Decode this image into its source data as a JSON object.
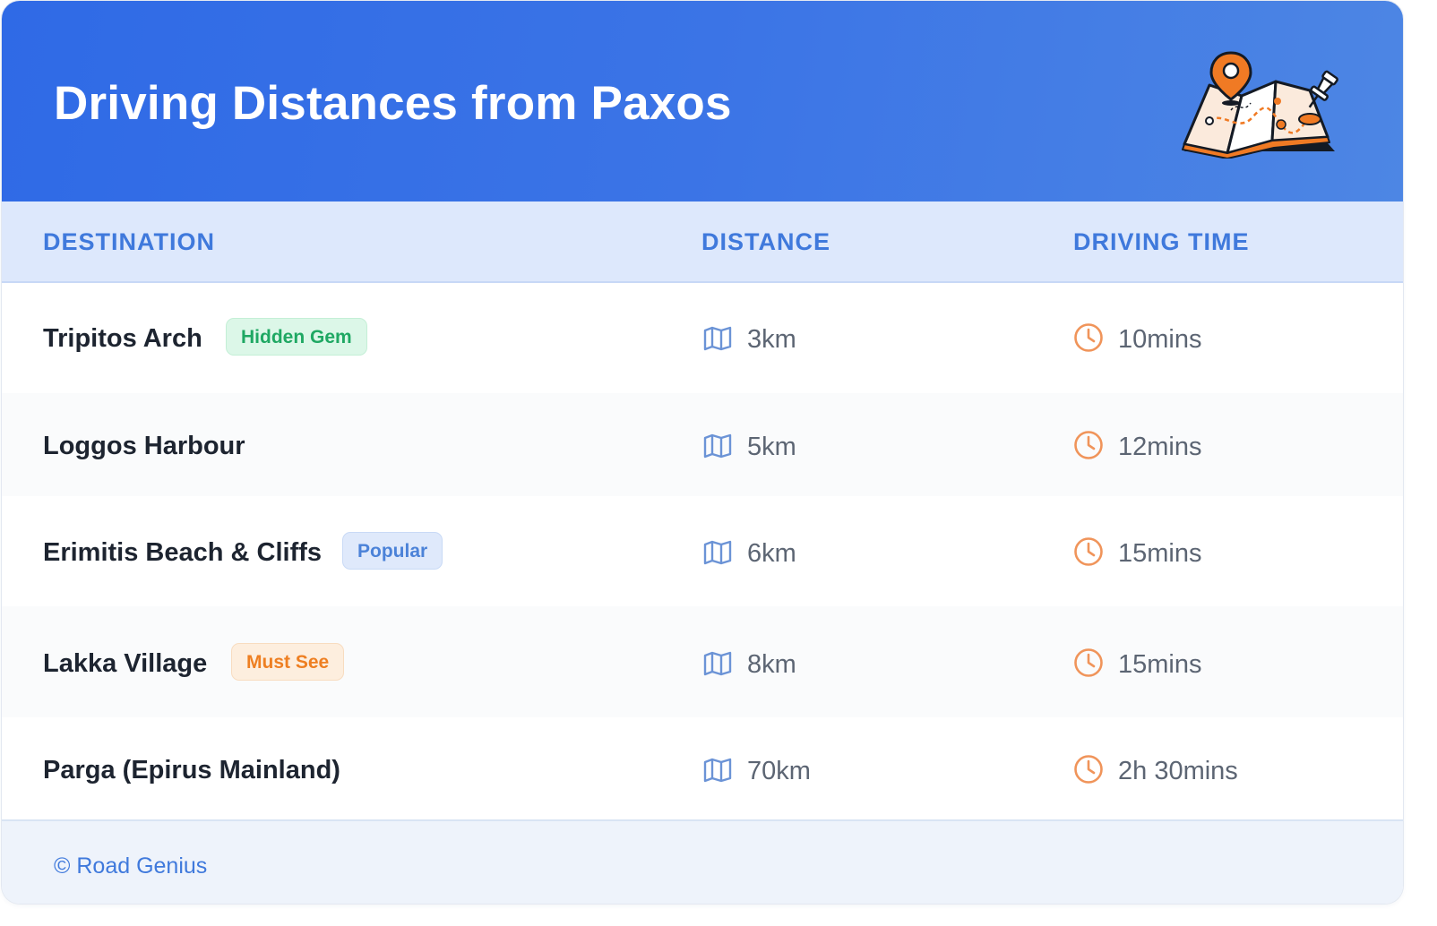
{
  "header": {
    "title": "Driving Distances from Paxos",
    "illustration": "map-with-pins-illustration"
  },
  "columns": {
    "destination": "DESTINATION",
    "distance": "DISTANCE",
    "driving_time": "DRIVING TIME"
  },
  "rows": [
    {
      "destination": "Tripitos Arch",
      "badge": "Hidden Gem",
      "distance": "3km",
      "time": "10mins"
    },
    {
      "destination": "Loggos Harbour",
      "badge": "",
      "distance": "5km",
      "time": "12mins"
    },
    {
      "destination": "Erimitis Beach & Cliffs",
      "badge": "Popular",
      "distance": "6km",
      "time": "15mins"
    },
    {
      "destination": "Lakka Village",
      "badge": "Must See",
      "distance": "8km",
      "time": "15mins"
    },
    {
      "destination": "Parga (Epirus Mainland)",
      "badge": "",
      "distance": "70km",
      "time": "2h 30mins"
    }
  ],
  "footer": {
    "text": "© Road Genius"
  },
  "icons": {
    "distance": "map-icon",
    "time": "clock-icon"
  },
  "colors": {
    "header_blue": "#2f6ae6",
    "accent_blue": "#3f79dc",
    "badge_green": "#1fa863",
    "badge_blue": "#4b82d8",
    "badge_orange": "#ee7f22",
    "icon_orange": "#f0945a",
    "icon_blue": "#6b93d6"
  }
}
